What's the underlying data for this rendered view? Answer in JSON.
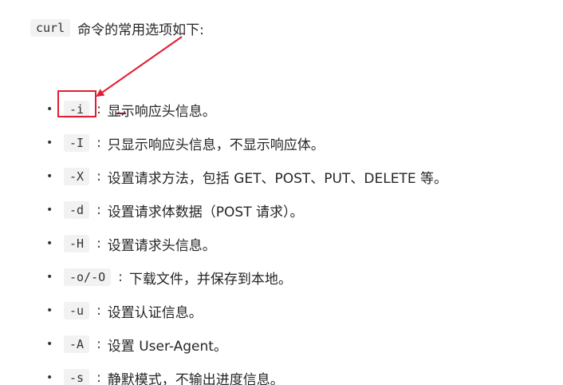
{
  "intro": {
    "code": "curl",
    "text": "命令的常用选项如下:"
  },
  "options": [
    {
      "flag": "-i",
      "sep": ":",
      "desc": "显示响应头信息。"
    },
    {
      "flag": "-I",
      "sep": ":",
      "desc": "只显示响应头信息，不显示响应体。"
    },
    {
      "flag": "-X",
      "sep": ":",
      "desc": "设置请求方法，包括 GET、POST、PUT、DELETE 等。"
    },
    {
      "flag": "-d",
      "sep": ":",
      "desc": "设置请求体数据（POST 请求）。"
    },
    {
      "flag": "-H",
      "sep": ":",
      "desc": "设置请求头信息。"
    },
    {
      "flag": "-o/-O",
      "sep": ":",
      "desc": "下载文件，并保存到本地。"
    },
    {
      "flag": "-u",
      "sep": ":",
      "desc": "设置认证信息。"
    },
    {
      "flag": "-A",
      "sep": ":",
      "desc": "设置 User-Agent。"
    },
    {
      "flag": "-s",
      "sep": ":",
      "desc": "静默模式，不输出进度信息。"
    }
  ],
  "bullet_char": "•",
  "colors": {
    "annotation": "#e01e2f",
    "code_bg": "#f2f2f2",
    "text": "#262626"
  }
}
